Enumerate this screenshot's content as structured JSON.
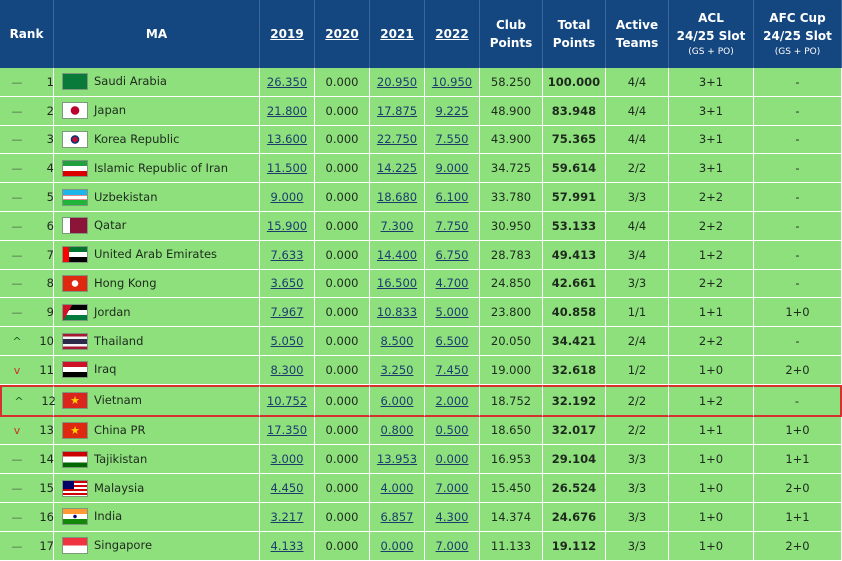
{
  "header": {
    "rank": "Rank",
    "ma": "MA",
    "y2019": "2019",
    "y2020": "2020",
    "y2021": "2021",
    "y2022": "2022",
    "club_points_1": "Club",
    "club_points_2": "Points",
    "total_points_1": "Total",
    "total_points_2": "Points",
    "active_teams_1": "Active",
    "active_teams_2": "Teams",
    "acl_1": "ACL",
    "acl_2": "24/25 Slot",
    "acl_sub": "(GS + PO)",
    "afc_1": "AFC Cup",
    "afc_2": "24/25 Slot",
    "afc_sub": "(GS + PO)"
  },
  "colors": {
    "header_bg": "#14467f",
    "row_bg": "#8ee07c",
    "highlight": "#d63030"
  },
  "rows": [
    {
      "trend": "same",
      "trend_symbol": "—",
      "rank": "1",
      "country": "Saudi Arabia",
      "flag_icon": "saudi-arabia-flag-icon",
      "y2019": "26.350",
      "y2020": "0.000",
      "y2021": "20.950",
      "y2022": "10.950",
      "club": "58.250",
      "total": "100.000",
      "teams": "4/4",
      "acl": "3+1",
      "afc": "-"
    },
    {
      "trend": "same",
      "trend_symbol": "—",
      "rank": "2",
      "country": "Japan",
      "flag_icon": "japan-flag-icon",
      "y2019": "21.800",
      "y2020": "0.000",
      "y2021": "17.875",
      "y2022": "9.225",
      "club": "48.900",
      "total": "83.948",
      "teams": "4/4",
      "acl": "3+1",
      "afc": "-"
    },
    {
      "trend": "same",
      "trend_symbol": "—",
      "rank": "3",
      "country": "Korea Republic",
      "flag_icon": "korea-republic-flag-icon",
      "y2019": "13.600",
      "y2020": "0.000",
      "y2021": "22.750",
      "y2022": "7.550",
      "club": "43.900",
      "total": "75.365",
      "teams": "4/4",
      "acl": "3+1",
      "afc": "-"
    },
    {
      "trend": "same",
      "trend_symbol": "—",
      "rank": "4",
      "country": "Islamic Republic of Iran",
      "flag_icon": "iran-flag-icon",
      "y2019": "11.500",
      "y2020": "0.000",
      "y2021": "14.225",
      "y2022": "9.000",
      "club": "34.725",
      "total": "59.614",
      "teams": "2/2",
      "acl": "3+1",
      "afc": "-"
    },
    {
      "trend": "same",
      "trend_symbol": "—",
      "rank": "5",
      "country": "Uzbekistan",
      "flag_icon": "uzbekistan-flag-icon",
      "y2019": "9.000",
      "y2020": "0.000",
      "y2021": "18.680",
      "y2022": "6.100",
      "club": "33.780",
      "total": "57.991",
      "teams": "3/3",
      "acl": "2+2",
      "afc": "-"
    },
    {
      "trend": "same",
      "trend_symbol": "—",
      "rank": "6",
      "country": "Qatar",
      "flag_icon": "qatar-flag-icon",
      "y2019": "15.900",
      "y2020": "0.000",
      "y2021": "7.300",
      "y2022": "7.750",
      "club": "30.950",
      "total": "53.133",
      "teams": "4/4",
      "acl": "2+2",
      "afc": "-"
    },
    {
      "trend": "same",
      "trend_symbol": "—",
      "rank": "7",
      "country": "United Arab Emirates",
      "flag_icon": "uae-flag-icon",
      "y2019": "7.633",
      "y2020": "0.000",
      "y2021": "14.400",
      "y2022": "6.750",
      "club": "28.783",
      "total": "49.413",
      "teams": "3/4",
      "acl": "1+2",
      "afc": "-"
    },
    {
      "trend": "same",
      "trend_symbol": "—",
      "rank": "8",
      "country": "Hong Kong",
      "flag_icon": "hong-kong-flag-icon",
      "y2019": "3.650",
      "y2020": "0.000",
      "y2021": "16.500",
      "y2022": "4.700",
      "club": "24.850",
      "total": "42.661",
      "teams": "3/3",
      "acl": "2+2",
      "afc": "-"
    },
    {
      "trend": "same",
      "trend_symbol": "—",
      "rank": "9",
      "country": "Jordan",
      "flag_icon": "jordan-flag-icon",
      "y2019": "7.967",
      "y2020": "0.000",
      "y2021": "10.833",
      "y2022": "5.000",
      "club": "23.800",
      "total": "40.858",
      "teams": "1/1",
      "acl": "1+1",
      "afc": "1+0"
    },
    {
      "trend": "up",
      "trend_symbol": "^",
      "rank": "10",
      "country": "Thailand",
      "flag_icon": "thailand-flag-icon",
      "y2019": "5.050",
      "y2020": "0.000",
      "y2021": "8.500",
      "y2022": "6.500",
      "club": "20.050",
      "total": "34.421",
      "teams": "2/4",
      "acl": "2+2",
      "afc": "-"
    },
    {
      "trend": "down",
      "trend_symbol": "v",
      "rank": "11",
      "country": "Iraq",
      "flag_icon": "iraq-flag-icon",
      "y2019": "8.300",
      "y2020": "0.000",
      "y2021": "3.250",
      "y2022": "7.450",
      "club": "19.000",
      "total": "32.618",
      "teams": "1/2",
      "acl": "1+0",
      "afc": "2+0"
    },
    {
      "trend": "up",
      "trend_symbol": "^",
      "rank": "12",
      "country": "Vietnam",
      "flag_icon": "vietnam-flag-icon",
      "y2019": "10.752",
      "y2020": "0.000",
      "y2021": "6.000",
      "y2022": "2.000",
      "club": "18.752",
      "total": "32.192",
      "teams": "2/2",
      "acl": "1+2",
      "afc": "-",
      "highlight": true
    },
    {
      "trend": "down",
      "trend_symbol": "v",
      "rank": "13",
      "country": "China PR",
      "flag_icon": "china-flag-icon",
      "y2019": "17.350",
      "y2020": "0.000",
      "y2021": "0.800",
      "y2022": "0.500",
      "club": "18.650",
      "total": "32.017",
      "teams": "2/2",
      "acl": "1+1",
      "afc": "1+0"
    },
    {
      "trend": "same",
      "trend_symbol": "—",
      "rank": "14",
      "country": "Tajikistan",
      "flag_icon": "tajikistan-flag-icon",
      "y2019": "3.000",
      "y2020": "0.000",
      "y2021": "13.953",
      "y2022": "0.000",
      "club": "16.953",
      "total": "29.104",
      "teams": "3/3",
      "acl": "1+0",
      "afc": "1+1"
    },
    {
      "trend": "same",
      "trend_symbol": "—",
      "rank": "15",
      "country": "Malaysia",
      "flag_icon": "malaysia-flag-icon",
      "y2019": "4.450",
      "y2020": "0.000",
      "y2021": "4.000",
      "y2022": "7.000",
      "club": "15.450",
      "total": "26.524",
      "teams": "3/3",
      "acl": "1+0",
      "afc": "2+0"
    },
    {
      "trend": "same",
      "trend_symbol": "—",
      "rank": "16",
      "country": "India",
      "flag_icon": "india-flag-icon",
      "y2019": "3.217",
      "y2020": "0.000",
      "y2021": "6.857",
      "y2022": "4.300",
      "club": "14.374",
      "total": "24.676",
      "teams": "3/3",
      "acl": "1+0",
      "afc": "1+1"
    },
    {
      "trend": "same",
      "trend_symbol": "—",
      "rank": "17",
      "country": "Singapore",
      "flag_icon": "singapore-flag-icon",
      "y2019": "4.133",
      "y2020": "0.000",
      "y2021": "0.000",
      "y2022": "7.000",
      "club": "11.133",
      "total": "19.112",
      "teams": "3/3",
      "acl": "1+0",
      "afc": "2+0"
    }
  ]
}
